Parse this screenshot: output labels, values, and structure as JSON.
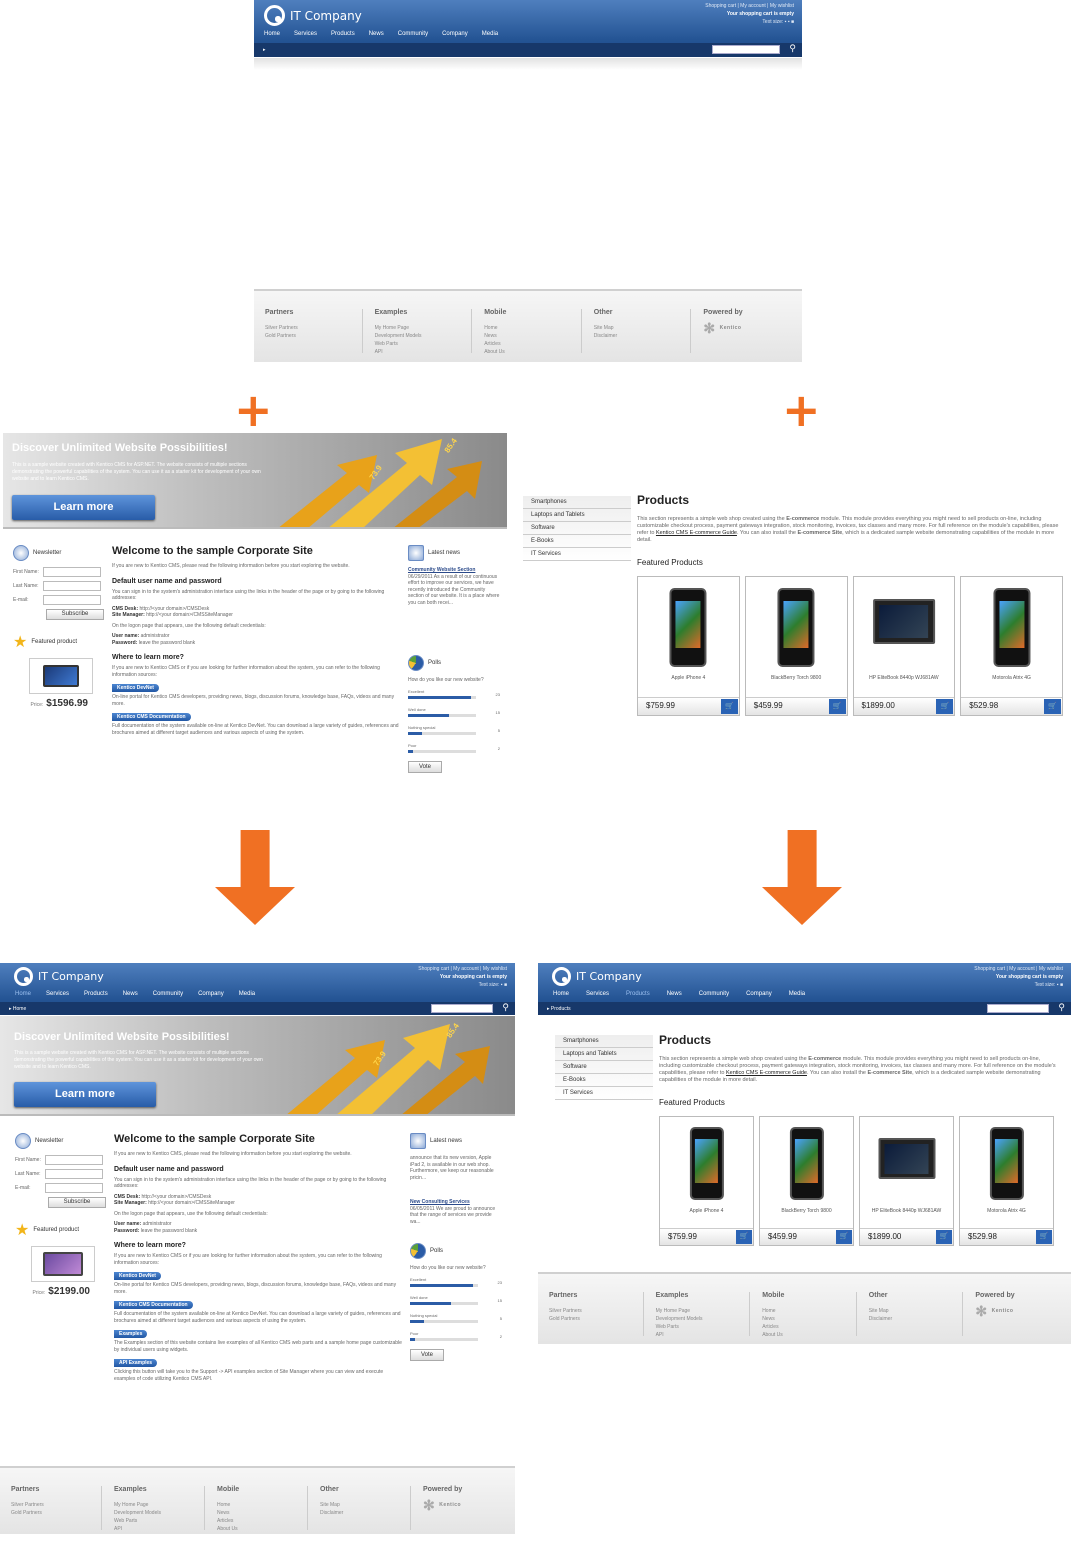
{
  "header": {
    "logo": "IT Company",
    "util_links": "Shopping cart | My account | My wishlist",
    "cart_status": "Your shopping cart is empty",
    "text_size": "Text size:",
    "nav": [
      "Home",
      "Services",
      "Products",
      "News",
      "Community",
      "Company",
      "Media"
    ],
    "breadcrumb_home": "Home",
    "breadcrumb_products": "Products"
  },
  "footer": {
    "columns": [
      {
        "title": "Partners",
        "items": [
          "Silver Partners",
          "Gold Partners"
        ]
      },
      {
        "title": "Examples",
        "items": [
          "My Home Page",
          "Development Models",
          "Web Parts",
          "API"
        ]
      },
      {
        "title": "Mobile",
        "items": [
          "Home",
          "News",
          "Articles",
          "About Us"
        ]
      },
      {
        "title": "Other",
        "items": [
          "Site Map",
          "Disclaimer"
        ]
      }
    ],
    "powered_by": "Powered by",
    "kentico": "Kentico"
  },
  "banner": {
    "title": "Discover Unlimited Website Possibilities!",
    "text": "This is a sample website created with Kentico CMS for ASP.NET. The website consists of multiple sections demonstrating the powerful capabilities of the system. You can use it as a starter kit for development of your own website and to learn Kentico CMS.",
    "button": "Learn more",
    "num1": "85.4",
    "num2": "73.9"
  },
  "corp": {
    "newsletter": "Newsletter",
    "first_name": "First Name:",
    "last_name": "Last Name:",
    "email": "E-mail:",
    "subscribe": "Subscribe",
    "featured": "Featured product",
    "price_label": "Price:",
    "price_a": "$1596.99",
    "price_b": "$2199.00",
    "welcome": "Welcome to the sample Corporate Site",
    "intro": "If you are new to Kentico CMS, please read the following information before you start exploring the website.",
    "default_h": "Default user name and password",
    "default_p": "You can sign in to the system's administration interface using the links in the header of the page or by going to the following addresses:",
    "cms_desk_l": "CMS Desk:",
    "cms_desk_v": "http://<your domain>/CMSDesk",
    "site_mgr_l": "Site Manager:",
    "site_mgr_v": "http://<your domain>/CMSSiteManager",
    "logon": "On the logon page that appears, use the following default credentials:",
    "user_l": "User name:",
    "user_v": "administrator",
    "pass_l": "Password:",
    "pass_v": "leave the password blank",
    "learn_h": "Where to learn more?",
    "learn_p": "If you are new to Kentico CMS or if you are looking for further information about the system, you can refer to the following information sources:",
    "devnet": "Kentico DevNet",
    "devnet_p": "On-line portal for Kentico CMS developers, providing news, blogs, discussion forums, knowledge base, FAQs, videos and many more.",
    "docs": "Kentico CMS Documentation",
    "docs_p": "Full documentation of the system available on-line at Kentico DevNet. You can download a large variety of guides, references and brochures aimed at different target audiences and various aspects of using the system.",
    "examples": "Examples",
    "examples_p": "The Examples section of this website contains live examples of all Kentico CMS web parts and a sample home page customizable by individual users using widgets.",
    "api": "API Examples",
    "api_p": "Clicking this button will take you to the Support -> API examples section of Site Manager where you can view and execute examples of code utilizing Kentico CMS API.",
    "latest": "Latest news",
    "news_a_title": "Community Website Section",
    "news_a_text": "06/29/2011 As a result of our continuous effort to improve our services, we have recently introduced the Community section of our website. It is a place where you can both recei...",
    "news_a_link": "Community",
    "news_b_text": "announce that its new version, Apple iPad 2, is available in our web shop. Furthermore, we keep our reasonable pricin...",
    "news_b_title": "New Consulting Services",
    "news_b_text2": "06/05/2011 We are proud to announce that the range of services we provide wa...",
    "polls": "Polls",
    "poll_q": "How do you like our new website?",
    "poll": [
      {
        "label": "Excellent",
        "count": "23",
        "pct": 0.92
      },
      {
        "label": "Well done",
        "count": "15",
        "pct": 0.6
      },
      {
        "label": "Nothing special",
        "count": "5",
        "pct": 0.2
      },
      {
        "label": "Poor",
        "count": "2",
        "pct": 0.08
      }
    ],
    "vote": "Vote"
  },
  "products": {
    "categories": [
      "Smartphones",
      "Laptops and Tablets",
      "Software",
      "E-Books",
      "IT Services"
    ],
    "title": "Products",
    "desc_1": "This section represents a simple web shop created using the ",
    "desc_mod": "E-commerce",
    "desc_2": " module. This module provides everything you might need to sell products on-line, including customizable checkout process, payment gateways integration, stock monitoring, invoices, tax classes and many more. For full reference on the module's capabilities, please refer to ",
    "desc_link": "Kentico CMS E-commerce Guide",
    "desc_3": ". You can also install the ",
    "desc_site": "E-commerce Site",
    "desc_4": ", which is a dedicated sample website demonstrating capabilities of the module in more detail.",
    "featured": "Featured Products",
    "items": [
      {
        "name": "Apple iPhone 4",
        "price": "$759.99",
        "kind": "phone"
      },
      {
        "name": "BlackBerry Torch 9800",
        "price": "$459.99",
        "kind": "phone"
      },
      {
        "name": "HP EliteBook 8440p WJ681AW",
        "price": "$1899.00",
        "kind": "laptop"
      },
      {
        "name": "Motorola Atrix 4G",
        "price": "$529.98",
        "kind": "phone"
      }
    ],
    "cart_icon": "cart-icon"
  },
  "colors": {
    "accent": "#f07023",
    "header_blue": "#245494"
  },
  "icons": {
    "plus": "+",
    "search": "search-icon"
  }
}
